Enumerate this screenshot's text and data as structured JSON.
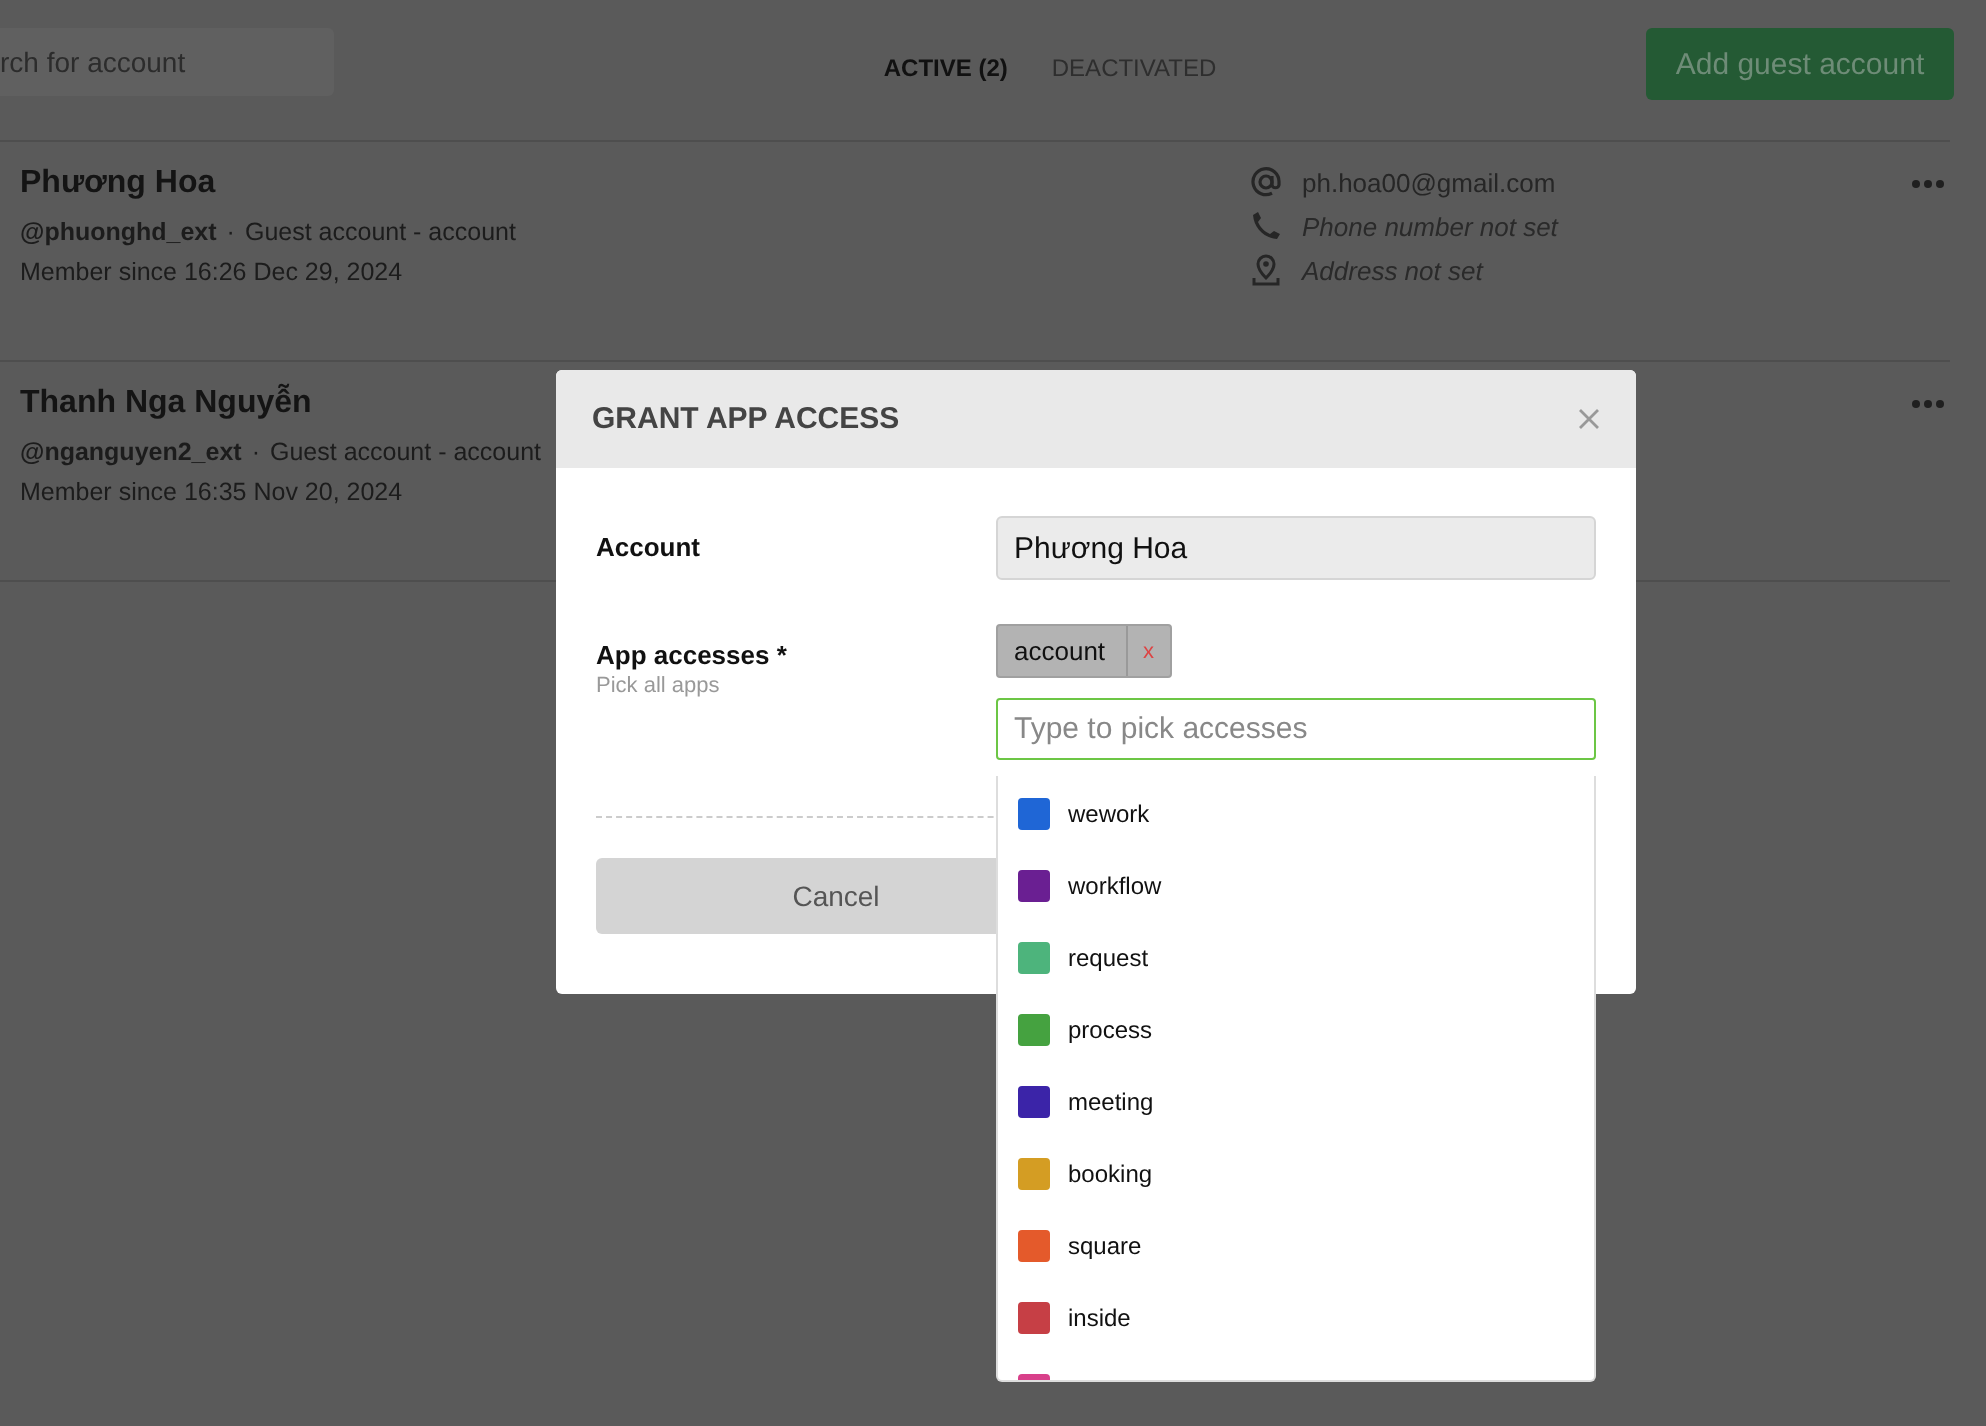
{
  "toolbar": {
    "search": {
      "placeholder": "rch for account"
    },
    "tabs": [
      {
        "label": "ACTIVE (2)",
        "selected": true
      },
      {
        "label": "DEACTIVATED",
        "selected": false
      }
    ],
    "add_button": "Add guest account"
  },
  "accounts": [
    {
      "name": "Phương Hoa",
      "handle": "@phuonghd_ext",
      "separator": "·",
      "type": "Guest account - account",
      "member_since": "Member since 16:26 Dec 29, 2024",
      "contacts": [
        {
          "kind": "email",
          "text": "ph.hoa00@gmail.com",
          "set": true
        },
        {
          "kind": "phone",
          "text": "Phone number not set",
          "set": false
        },
        {
          "kind": "address",
          "text": "Address not set",
          "set": false
        }
      ]
    },
    {
      "name": "Thanh Nga Nguyễn",
      "handle": "@nganguyen2_ext",
      "separator": "·",
      "type": "Guest account - account",
      "member_since": "Member since 16:35 Nov 20, 2024"
    }
  ],
  "dialog": {
    "title": "GRANT APP ACCESS",
    "account_label": "Account",
    "account_value": "Phương Hoa",
    "accesses_label": "App accesses *",
    "accesses_hint": "Pick all apps",
    "chips": [
      {
        "label": "account",
        "remove": "x"
      }
    ],
    "picker": {
      "placeholder": "Type to pick accesses"
    },
    "cancel_button": "Cancel",
    "options": [
      {
        "label": "wework",
        "color": "#1f66d6"
      },
      {
        "label": "workflow",
        "color": "#6a1f92"
      },
      {
        "label": "request",
        "color": "#4db47c"
      },
      {
        "label": "process",
        "color": "#45a240"
      },
      {
        "label": "meeting",
        "color": "#3b24a8"
      },
      {
        "label": "booking",
        "color": "#d49d23"
      },
      {
        "label": "square",
        "color": "#e45a2b"
      },
      {
        "label": "inside",
        "color": "#c63f45"
      },
      {
        "color": "#d8408a"
      }
    ]
  }
}
